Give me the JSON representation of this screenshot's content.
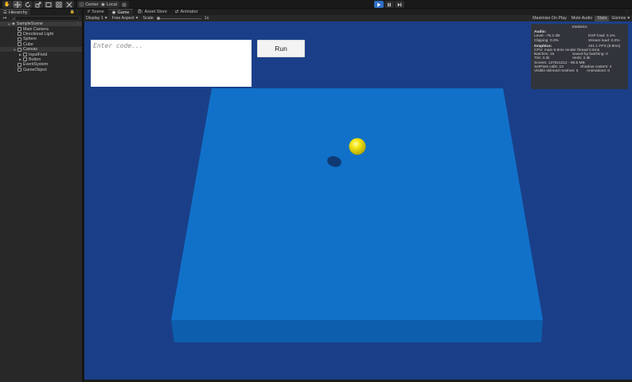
{
  "toolbar": {
    "pivot_mode": "Center",
    "pivot_rotation": "Local"
  },
  "hierarchy": {
    "tab_label": "Hierarchy",
    "search_placeholder": "All",
    "scene_name": "SampleScene",
    "items": [
      {
        "label": "Main Camera",
        "indent": 1,
        "has_children": false
      },
      {
        "label": "Directional Light",
        "indent": 1,
        "has_children": false
      },
      {
        "label": "Sphere",
        "indent": 1,
        "has_children": false
      },
      {
        "label": "Cube",
        "indent": 1,
        "has_children": false
      },
      {
        "label": "Canvas",
        "indent": 1,
        "has_children": true
      },
      {
        "label": "InputField",
        "indent": 2,
        "has_children": true
      },
      {
        "label": "Button",
        "indent": 2,
        "has_children": true
      },
      {
        "label": "EventSystem",
        "indent": 1,
        "has_children": false
      },
      {
        "label": "GameObject",
        "indent": 1,
        "has_children": false
      }
    ]
  },
  "view_tabs": [
    {
      "label": "Scene",
      "active": false
    },
    {
      "label": "Game",
      "active": true
    },
    {
      "label": "Asset Store",
      "active": false
    },
    {
      "label": "Animator",
      "active": false
    }
  ],
  "game_toolbar": {
    "display": "Display 1",
    "aspect": "Free Aspect",
    "scale_label": "Scale",
    "scale_value": "1x",
    "maximize_on_play": "Maximize On Play",
    "mute_audio": "Mute Audio",
    "stats": "Stats",
    "gizmos": "Gizmos"
  },
  "game_ui": {
    "input_placeholder": "Enter code...",
    "run_label": "Run"
  },
  "statistics": {
    "title": "Statistics",
    "audio_head": "Audio:",
    "level": "Level: -75.2 dB",
    "clipping": "Clipping: 0.0%",
    "dsp_load": "DSP load: 0.1%",
    "stream_load": "Stream load: 0.0%",
    "graphics_head": "Graphics:",
    "fps": "101.1 FPS (9.9ms)",
    "cpu": "CPU: main 9.9ms  render thread 0.5ms",
    "batches": "Batches: 15",
    "saved_batching": "Saved by batching: 0",
    "tris": "Tris: 3.2k",
    "verts": "Verts: 2.3k",
    "screen": "Screen: 1376x1212 - 95.5 MB",
    "setpass": "SetPass calls: 13",
    "shadow_casters": "Shadow casters: 4",
    "skinned": "Visible skinned meshes: 0",
    "animations": "Animations: 0"
  },
  "colors": {
    "sky": "#1a3f88",
    "platform_top": "#1171c9",
    "platform_front": "#0d5fae",
    "ball": "#f3e400",
    "play_active": "#2f6fc4"
  }
}
